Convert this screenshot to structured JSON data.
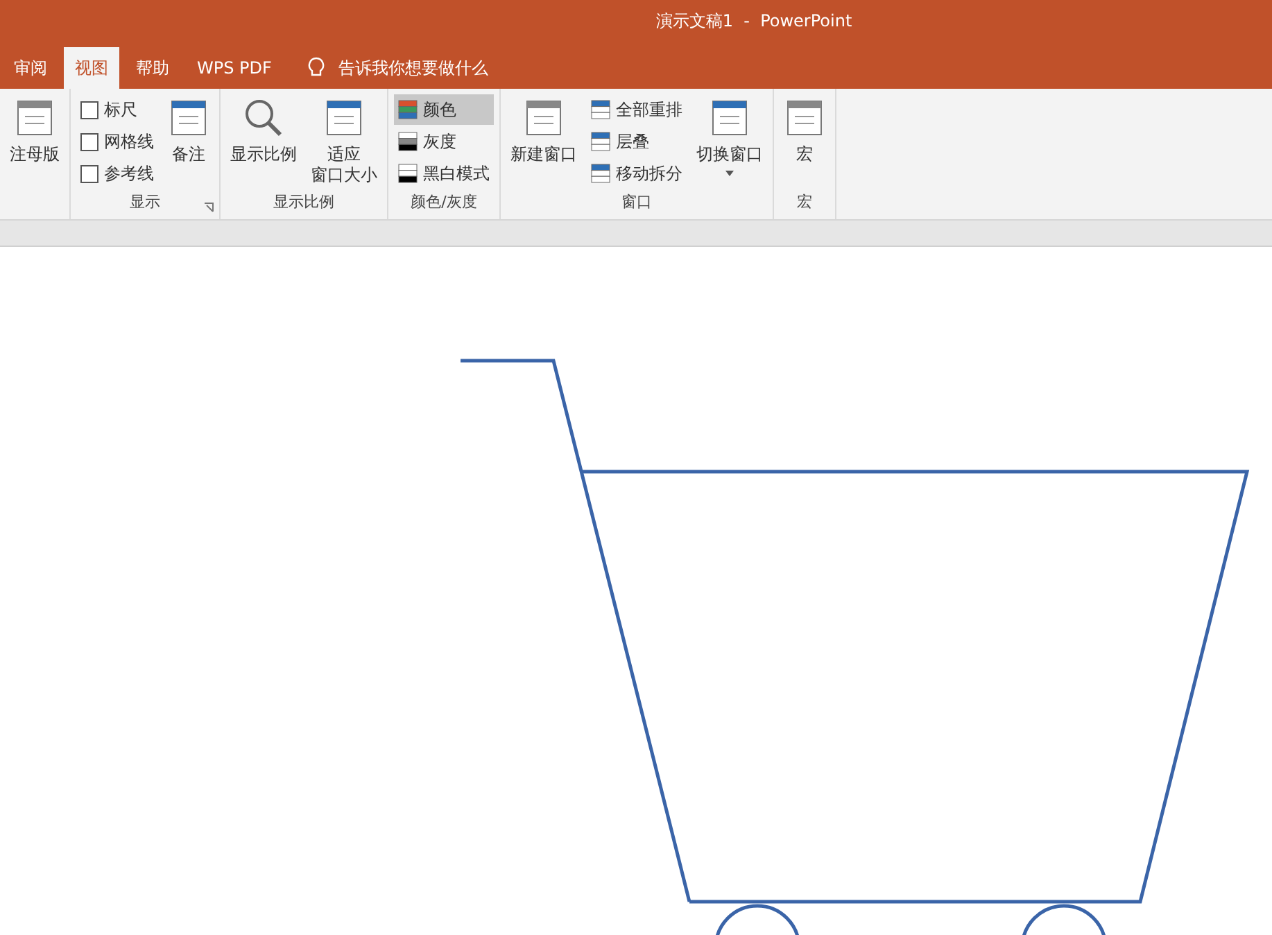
{
  "window": {
    "title": "演示文稿1  -  PowerPoint"
  },
  "tabs": [
    {
      "label": "审阅",
      "selected": false
    },
    {
      "label": "视图",
      "selected": true
    },
    {
      "label": "帮助",
      "selected": false
    },
    {
      "label": "WPS PDF",
      "selected": false
    }
  ],
  "tell_me": {
    "placeholder": "告诉我你想要做什么"
  },
  "ribbon": {
    "groups": [
      {
        "items": [
          {
            "kind": "large",
            "label": "注母版"
          }
        ]
      },
      {
        "label": "显示",
        "launcher": true,
        "items": [
          {
            "kind": "checks",
            "options": [
              {
                "label": "标尺",
                "checked": false
              },
              {
                "label": "网格线",
                "checked": false
              },
              {
                "label": "参考线",
                "checked": false
              }
            ]
          },
          {
            "kind": "large",
            "label": "备注"
          }
        ]
      },
      {
        "label": "显示比例",
        "items": [
          {
            "kind": "large",
            "label": "显示比例"
          },
          {
            "kind": "large",
            "lines": [
              "适应",
              "窗口大小"
            ]
          }
        ]
      },
      {
        "label": "颜色/灰度",
        "items": [
          {
            "kind": "small",
            "options": [
              {
                "label": "颜色",
                "selected": true
              },
              {
                "label": "灰度",
                "selected": false
              },
              {
                "label": "黑白模式",
                "selected": false
              }
            ]
          }
        ]
      },
      {
        "label": "窗口",
        "items": [
          {
            "kind": "large",
            "label": "新建窗口"
          },
          {
            "kind": "small",
            "options": [
              {
                "label": "全部重排",
                "selected": false
              },
              {
                "label": "层叠",
                "selected": false
              },
              {
                "label": "移动拆分",
                "selected": false
              }
            ]
          },
          {
            "kind": "large",
            "label": "切换窗口",
            "dropdown": true
          }
        ]
      },
      {
        "label": "宏",
        "items": [
          {
            "kind": "large",
            "label": "宏"
          }
        ]
      }
    ]
  }
}
